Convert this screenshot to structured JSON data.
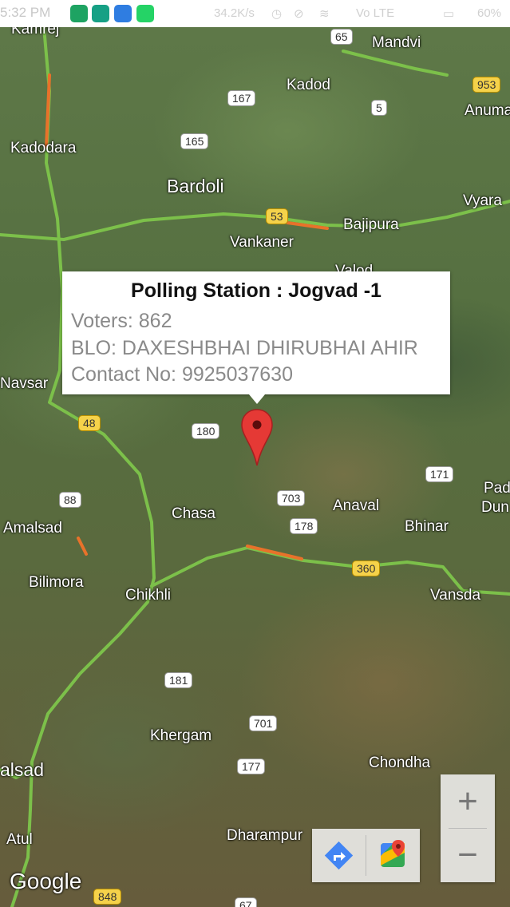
{
  "status_bar": {
    "time": "5:32 PM",
    "speed": "34.2K/s",
    "network": "Vo LTE",
    "battery": "60%"
  },
  "map": {
    "places": [
      {
        "id": "kamrej",
        "name": "Kamrej"
      },
      {
        "id": "mandvi",
        "name": "Mandvi"
      },
      {
        "id": "kadod",
        "name": "Kadod"
      },
      {
        "id": "anuma",
        "name": "Anuma"
      },
      {
        "id": "kadodara",
        "name": "Kadodara"
      },
      {
        "id": "bardoli",
        "name": "Bardoli"
      },
      {
        "id": "vyara",
        "name": "Vyara"
      },
      {
        "id": "bajipura",
        "name": "Bajipura"
      },
      {
        "id": "vankaner",
        "name": "Vankaner"
      },
      {
        "id": "valod",
        "name": "Valod"
      },
      {
        "id": "navsari",
        "name": "Navsar"
      },
      {
        "id": "chasa",
        "name": "Chasa"
      },
      {
        "id": "anaval",
        "name": "Anaval"
      },
      {
        "id": "bhinar",
        "name": "Bhinar"
      },
      {
        "id": "pad",
        "name": "Pad"
      },
      {
        "id": "dun",
        "name": "Dun"
      },
      {
        "id": "amalsad",
        "name": "Amalsad"
      },
      {
        "id": "bilimora",
        "name": "Bilimora"
      },
      {
        "id": "chikhli",
        "name": "Chikhli"
      },
      {
        "id": "vansda",
        "name": "Vansda"
      },
      {
        "id": "khergam",
        "name": "Khergam"
      },
      {
        "id": "chondha",
        "name": "Chondha"
      },
      {
        "id": "valsad",
        "name": "alsad"
      },
      {
        "id": "dharampur",
        "name": "Dharampur"
      },
      {
        "id": "atul",
        "name": "Atul"
      }
    ],
    "shields": [
      {
        "id": "s65",
        "label": "65",
        "style": "white"
      },
      {
        "id": "s167",
        "label": "167",
        "style": "white"
      },
      {
        "id": "s5",
        "label": "5",
        "style": "white"
      },
      {
        "id": "s953",
        "label": "953",
        "style": "yellow"
      },
      {
        "id": "s165",
        "label": "165",
        "style": "white"
      },
      {
        "id": "s53",
        "label": "53",
        "style": "yellow"
      },
      {
        "id": "s48",
        "label": "48",
        "style": "yellow"
      },
      {
        "id": "s180",
        "label": "180",
        "style": "white"
      },
      {
        "id": "s171",
        "label": "171",
        "style": "white"
      },
      {
        "id": "s88",
        "label": "88",
        "style": "white"
      },
      {
        "id": "s703",
        "label": "703",
        "style": "white"
      },
      {
        "id": "s178",
        "label": "178",
        "style": "white"
      },
      {
        "id": "s360",
        "label": "360",
        "style": "yellow"
      },
      {
        "id": "s181",
        "label": "181",
        "style": "white"
      },
      {
        "id": "s701",
        "label": "701",
        "style": "white"
      },
      {
        "id": "s177",
        "label": "177",
        "style": "white"
      },
      {
        "id": "s848",
        "label": "848",
        "style": "yellow"
      },
      {
        "id": "s67",
        "label": "67",
        "style": "white"
      }
    ],
    "attribution": "Google"
  },
  "popup": {
    "title": "Polling Station : Jogvad -1",
    "voters": "Voters: 862",
    "blo": "BLO: DAXESHBHAI DHIRUBHAI AHIR",
    "contact": "Contact No: 9925037630"
  },
  "controls": {
    "zoom_in": "+",
    "zoom_out": "−"
  },
  "colors": {
    "marker": "#e53935",
    "road": "#7cc04a",
    "traffic": "#e8722a",
    "national_highway": "#f5d24a"
  }
}
